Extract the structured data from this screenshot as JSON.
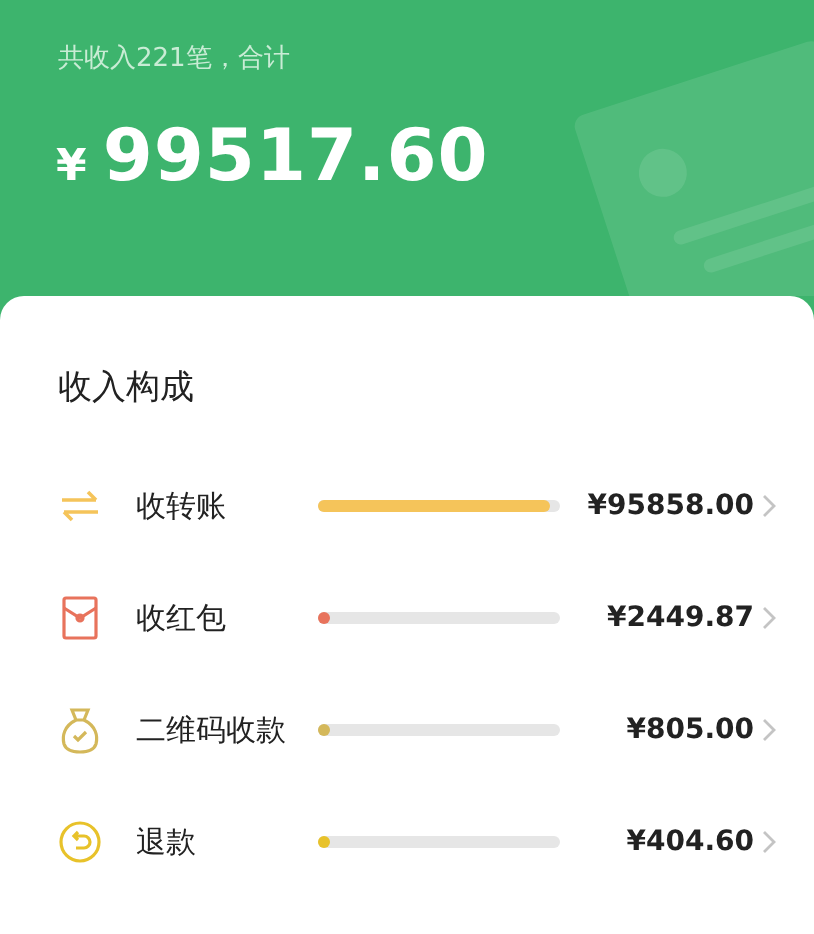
{
  "summary": {
    "caption": "共收入221笔，合计",
    "currency": "¥",
    "total": "99517.60"
  },
  "breakdown": {
    "title": "收入构成",
    "items": [
      {
        "kind": "transfer",
        "label": "收转账",
        "level": 0.96,
        "color": "#f5c45a",
        "amount": "¥95858.00"
      },
      {
        "kind": "red-packet",
        "label": "收红包",
        "level": 0.025,
        "color": "#e8735c",
        "amount": "¥2449.87"
      },
      {
        "kind": "money-bag",
        "label": "二维码收款",
        "level": 0.008,
        "color": "#d4b85a",
        "amount": "¥805.00"
      },
      {
        "kind": "refund",
        "label": "退款",
        "level": 0.004,
        "color": "#e8c22a",
        "amount": "¥404.60"
      }
    ]
  }
}
